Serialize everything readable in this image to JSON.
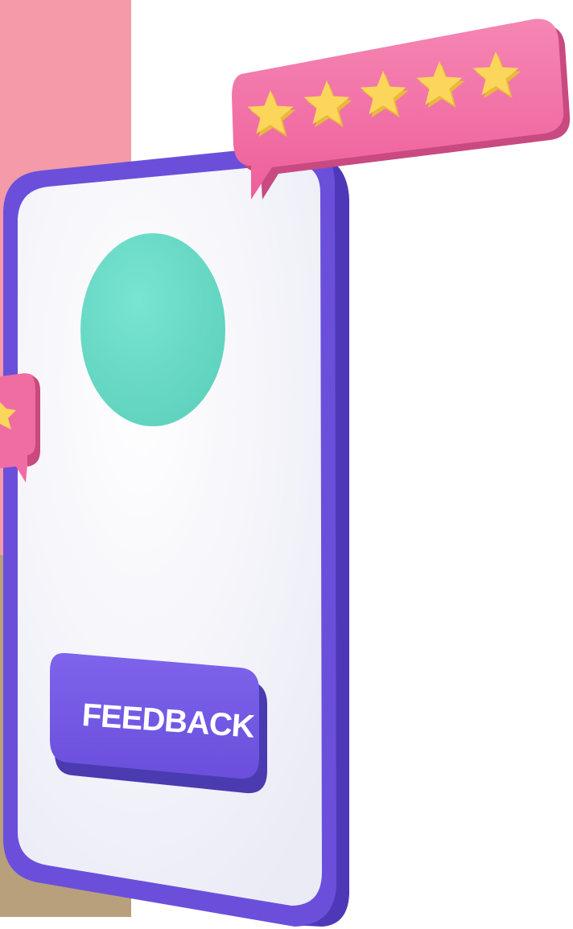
{
  "feedback_button": {
    "label": "FEEDBACK"
  },
  "rating": {
    "stars_filled": 5,
    "stars_total": 5
  },
  "colors": {
    "backdrop_pink": "#f49aa8",
    "backdrop_tan": "#b8a07d",
    "phone_frame": "#6b4fdb",
    "phone_frame_side": "#4f38b8",
    "phone_screen": "#f3f3fb",
    "avatar_circle": "#68dbc7",
    "button_fill": "#7458e6",
    "button_shadow": "#4a3bb0",
    "bubble_pink": "#f06da2",
    "bubble_pink_dark": "#c84a80",
    "star_fill": "#fbd65a",
    "star_shade": "#e9b93a"
  },
  "icons": {
    "rating_star": "star-icon",
    "speech_bubble": "speech-bubble-icon"
  }
}
